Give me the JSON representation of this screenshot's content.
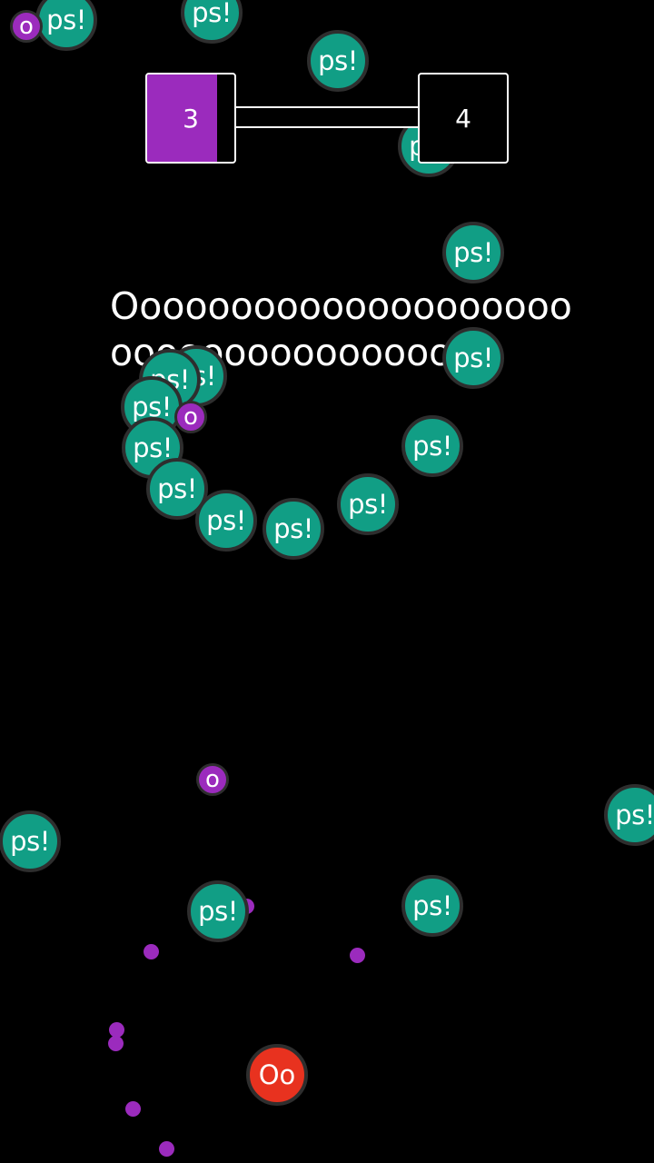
{
  "level": {
    "current": "3",
    "next": "4",
    "progress": 0.0,
    "current_box_fill": 0.8
  },
  "yell_text": "Oooooooooooooooooooooooooooooooooooo",
  "player": {
    "label": "Oo",
    "color": "#e8321f"
  },
  "enemy": {
    "label": "ps!",
    "color": "#119e85"
  },
  "collectible": {
    "label": "o",
    "color": "#9b2bbd"
  },
  "colors": {
    "background": "#000000",
    "accent": "#9b2bbd",
    "outline": "#2e2e2e"
  }
}
